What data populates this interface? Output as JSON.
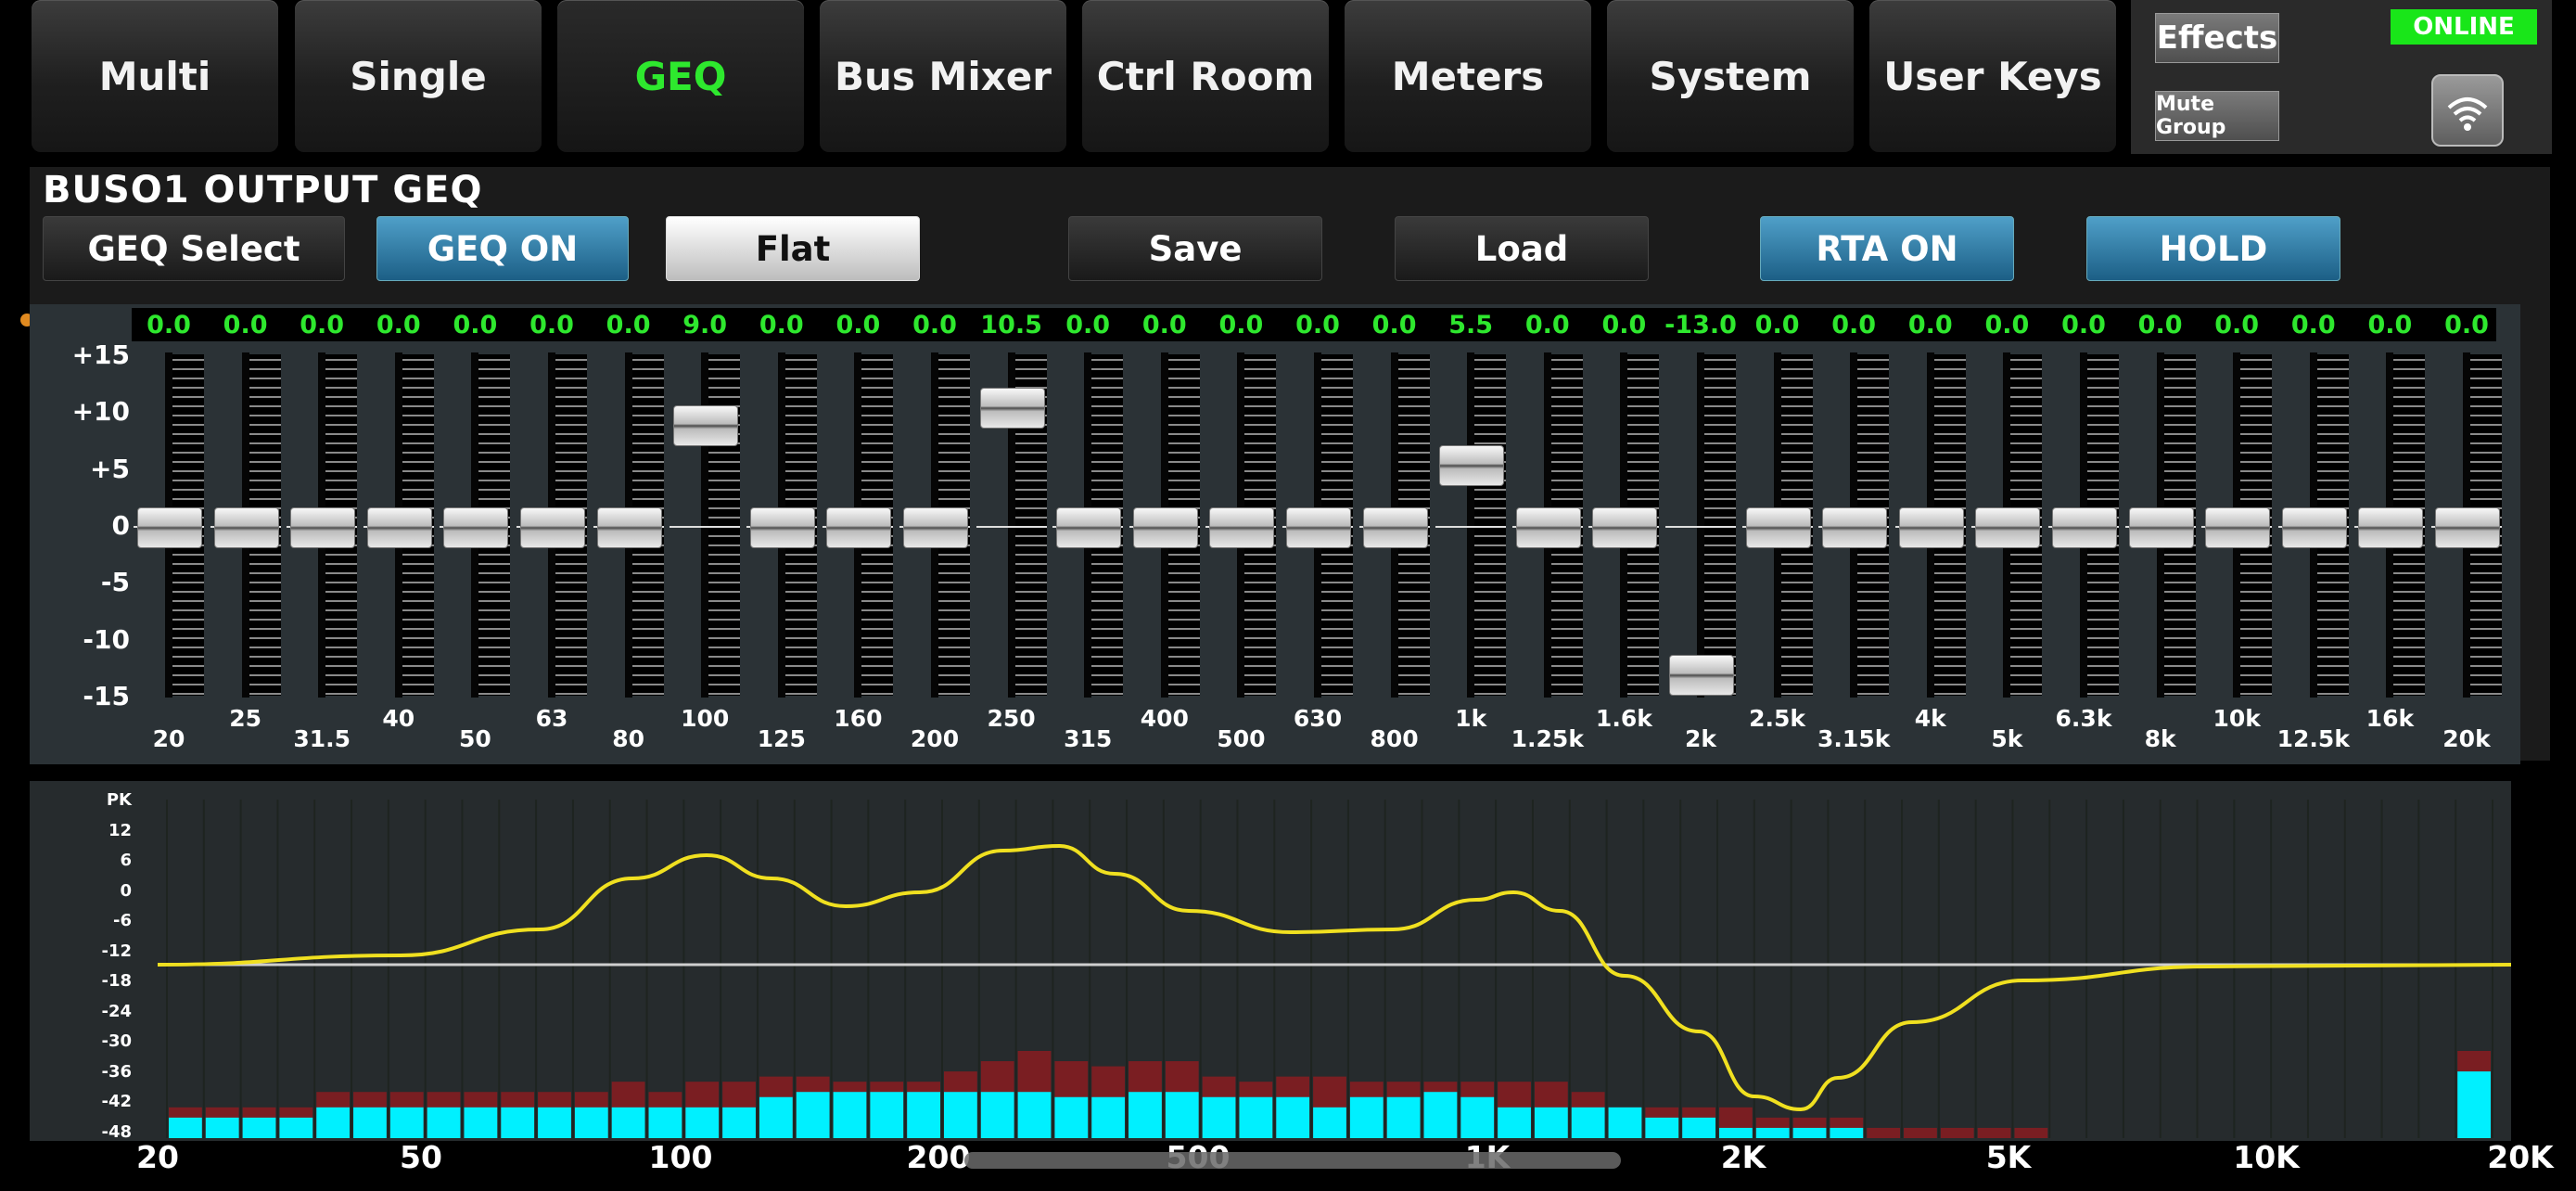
{
  "nav": {
    "tabs": [
      "Multi",
      "Single",
      "GEQ",
      "Bus Mixer",
      "Ctrl Room",
      "Meters",
      "System",
      "User Keys"
    ],
    "active_tab": "GEQ",
    "effects_label": "Effects",
    "mute_group_label": "Mute Group",
    "status": "ONLINE",
    "status_color": "#19e619",
    "wifi_icon": "wifi-icon"
  },
  "geq": {
    "title": "BUSO1 OUTPUT GEQ",
    "buttons": {
      "geq_select": "GEQ Select",
      "geq_on": "GEQ ON",
      "flat": "Flat",
      "save": "Save",
      "load": "Load",
      "rta_on": "RTA ON",
      "hold": "HOLD"
    },
    "scale_labels": [
      "+15",
      "+10",
      "+5",
      "0",
      "-5",
      "-10",
      "-15"
    ],
    "bands": [
      {
        "freq": "20",
        "gain": 0.0,
        "label": "0.0"
      },
      {
        "freq": "25",
        "gain": 0.0,
        "label": "0.0"
      },
      {
        "freq": "31.5",
        "gain": 0.0,
        "label": "0.0"
      },
      {
        "freq": "40",
        "gain": 0.0,
        "label": "0.0"
      },
      {
        "freq": "50",
        "gain": 0.0,
        "label": "0.0"
      },
      {
        "freq": "63",
        "gain": 0.0,
        "label": "0.0"
      },
      {
        "freq": "80",
        "gain": 0.0,
        "label": "0.0"
      },
      {
        "freq": "100",
        "gain": 9.0,
        "label": "9.0"
      },
      {
        "freq": "125",
        "gain": 0.0,
        "label": "0.0"
      },
      {
        "freq": "160",
        "gain": 0.0,
        "label": "0.0"
      },
      {
        "freq": "200",
        "gain": 0.0,
        "label": "0.0"
      },
      {
        "freq": "250",
        "gain": 10.5,
        "label": "10.5"
      },
      {
        "freq": "315",
        "gain": 0.0,
        "label": "0.0"
      },
      {
        "freq": "400",
        "gain": 0.0,
        "label": "0.0"
      },
      {
        "freq": "500",
        "gain": 0.0,
        "label": "0.0"
      },
      {
        "freq": "630",
        "gain": 0.0,
        "label": "0.0"
      },
      {
        "freq": "800",
        "gain": 0.0,
        "label": "0.0"
      },
      {
        "freq": "1k",
        "gain": 5.5,
        "label": "5.5"
      },
      {
        "freq": "1.25k",
        "gain": 0.0,
        "label": "0.0"
      },
      {
        "freq": "1.6k",
        "gain": 0.0,
        "label": "0.0"
      },
      {
        "freq": "2k",
        "gain": -13.0,
        "label": "-13.0"
      },
      {
        "freq": "2.5k",
        "gain": 0.0,
        "label": "0.0"
      },
      {
        "freq": "3.15k",
        "gain": 0.0,
        "label": "0.0"
      },
      {
        "freq": "4k",
        "gain": 0.0,
        "label": "0.0"
      },
      {
        "freq": "5k",
        "gain": 0.0,
        "label": "0.0"
      },
      {
        "freq": "6.3k",
        "gain": 0.0,
        "label": "0.0"
      },
      {
        "freq": "8k",
        "gain": 0.0,
        "label": "0.0"
      },
      {
        "freq": "10k",
        "gain": 0.0,
        "label": "0.0"
      },
      {
        "freq": "12.5k",
        "gain": 0.0,
        "label": "0.0"
      },
      {
        "freq": "16k",
        "gain": 0.0,
        "label": "0.0"
      },
      {
        "freq": "20k",
        "gain": 0.0,
        "label": "0.0"
      }
    ]
  },
  "rta": {
    "y_labels": [
      "PK",
      "12",
      "6",
      "0",
      "-6",
      "-12",
      "-18",
      "-24",
      "-30",
      "-36",
      "-42",
      "-48"
    ],
    "x_labels": [
      "20",
      "50",
      "100",
      "200",
      "500",
      "1K",
      "2K",
      "5K",
      "10K",
      "20K"
    ],
    "curve_color": "#f0e020",
    "bar_color": "#00f0ff",
    "peak_color": "#7a1e22",
    "bars": [
      {
        "level": -44,
        "peak": -42
      },
      {
        "level": -44,
        "peak": -42
      },
      {
        "level": -44,
        "peak": -42
      },
      {
        "level": -44,
        "peak": -42
      },
      {
        "level": -42,
        "peak": -39
      },
      {
        "level": -42,
        "peak": -39
      },
      {
        "level": -42,
        "peak": -39
      },
      {
        "level": -42,
        "peak": -39
      },
      {
        "level": -42,
        "peak": -39
      },
      {
        "level": -42,
        "peak": -39
      },
      {
        "level": -42,
        "peak": -39
      },
      {
        "level": -42,
        "peak": -39
      },
      {
        "level": -42,
        "peak": -37
      },
      {
        "level": -42,
        "peak": -39
      },
      {
        "level": -42,
        "peak": -37
      },
      {
        "level": -42,
        "peak": -37
      },
      {
        "level": -40,
        "peak": -36
      },
      {
        "level": -39,
        "peak": -36
      },
      {
        "level": -39,
        "peak": -37
      },
      {
        "level": -39,
        "peak": -37
      },
      {
        "level": -39,
        "peak": -37
      },
      {
        "level": -39,
        "peak": -35
      },
      {
        "level": -39,
        "peak": -33
      },
      {
        "level": -39,
        "peak": -31
      },
      {
        "level": -40,
        "peak": -33
      },
      {
        "level": -40,
        "peak": -34
      },
      {
        "level": -39,
        "peak": -33
      },
      {
        "level": -39,
        "peak": -33
      },
      {
        "level": -40,
        "peak": -36
      },
      {
        "level": -40,
        "peak": -37
      },
      {
        "level": -40,
        "peak": -36
      },
      {
        "level": -42,
        "peak": -36
      },
      {
        "level": -40,
        "peak": -37
      },
      {
        "level": -40,
        "peak": -37
      },
      {
        "level": -39,
        "peak": -37
      },
      {
        "level": -40,
        "peak": -37
      },
      {
        "level": -42,
        "peak": -37
      },
      {
        "level": -42,
        "peak": -37
      },
      {
        "level": -42,
        "peak": -39
      },
      {
        "level": -42,
        "peak": -42
      },
      {
        "level": -44,
        "peak": -42
      },
      {
        "level": -44,
        "peak": -42
      },
      {
        "level": -46,
        "peak": -42
      },
      {
        "level": -46,
        "peak": -44
      },
      {
        "level": -46,
        "peak": -44
      },
      {
        "level": -46,
        "peak": -44
      },
      {
        "level": -48,
        "peak": -46
      },
      {
        "level": -48,
        "peak": -46
      },
      {
        "level": -48,
        "peak": -46
      },
      {
        "level": -48,
        "peak": -46
      },
      {
        "level": -48,
        "peak": -46
      },
      {
        "level": -48,
        "peak": -48
      },
      {
        "level": -48,
        "peak": -48
      },
      {
        "level": -48,
        "peak": -48
      },
      {
        "level": -48,
        "peak": -48
      },
      {
        "level": -48,
        "peak": -48
      },
      {
        "level": -48,
        "peak": -48
      },
      {
        "level": -48,
        "peak": -48
      },
      {
        "level": -48,
        "peak": -48
      },
      {
        "level": -48,
        "peak": -48
      },
      {
        "level": -48,
        "peak": -48
      },
      {
        "level": -48,
        "peak": -48
      },
      {
        "level": -35,
        "peak": -31
      }
    ]
  }
}
